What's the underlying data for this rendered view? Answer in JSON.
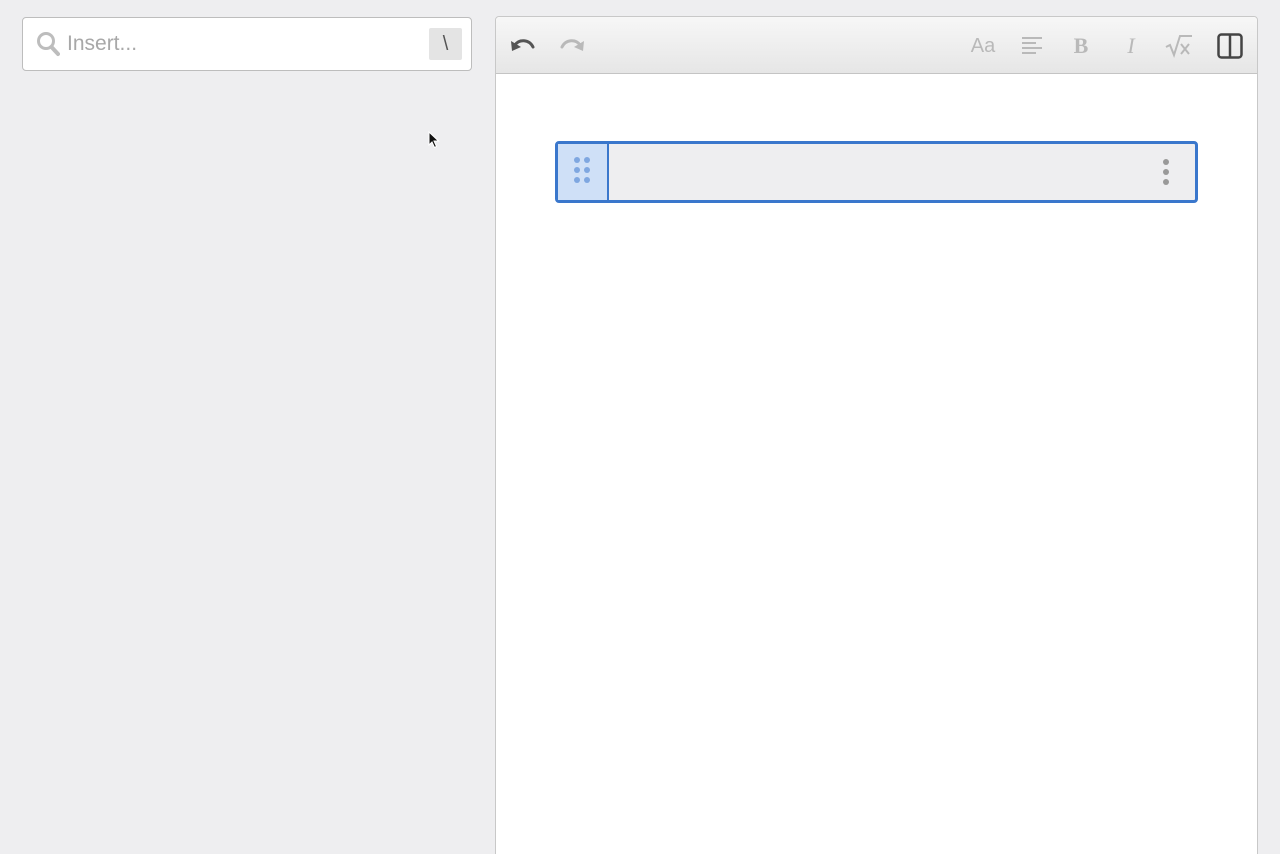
{
  "search": {
    "placeholder": "Insert...",
    "value": "",
    "shortcut_key": "\\"
  },
  "toolbar": {
    "undo_icon": "undo-icon",
    "redo_icon": "redo-icon",
    "font_size_label": "Aa",
    "align_icon": "align-left-icon",
    "bold_label": "B",
    "italic_label": "I",
    "formula_icon": "formula-icon",
    "split_view_icon": "split-view-icon"
  },
  "block": {
    "state": "selected",
    "text": "",
    "drag_handle_icon": "drag-handle-icon",
    "menu_icon": "more-vertical-icon"
  },
  "colors": {
    "accent": "#3a77cc",
    "accent_light": "#cfe0f7",
    "background": "#eeeef0"
  }
}
